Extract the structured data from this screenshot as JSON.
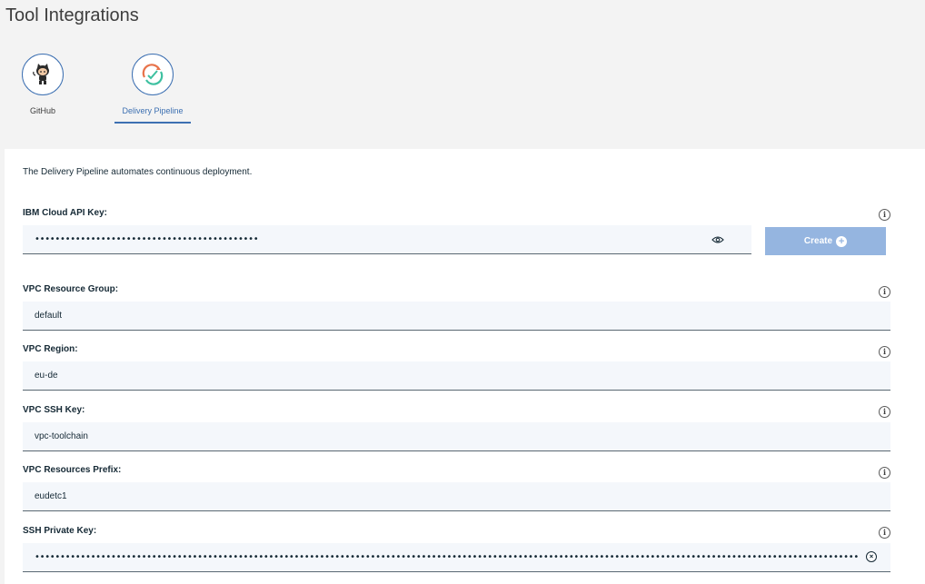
{
  "page": {
    "title": "Tool Integrations"
  },
  "tools": [
    {
      "name": "GitHub",
      "icon": "github-octocat-icon",
      "selected": false
    },
    {
      "name": "Delivery Pipeline",
      "icon": "delivery-pipeline-icon",
      "selected": true
    }
  ],
  "description": "The Delivery Pipeline automates continuous deployment.",
  "fields": {
    "api_key": {
      "label": "IBM Cloud API Key:",
      "value": "••••••••••••••••••••••••••••••••••••••••••••",
      "icon": "eye-icon"
    },
    "create_button": {
      "label": "Create",
      "icon": "plus-circle-icon"
    },
    "resource_group": {
      "label": "VPC Resource Group:",
      "value": "default"
    },
    "region": {
      "label": "VPC Region:",
      "value": "eu-de"
    },
    "ssh_key": {
      "label": "VPC SSH Key:",
      "value": "vpc-toolchain"
    },
    "prefix": {
      "label": "VPC Resources Prefix:",
      "value": "eudetc1"
    },
    "private_key": {
      "label": "SSH Private Key:",
      "value": "••••••••••••••••••••••••••••••••••••••••••••••••••••••••••••••••••••••••••••••••••••••••••••••••••••••••••••••••••••••••••••••••••••••••••••••••••••••••••••••••••••••••••••••••••••••••••••••••••••••••••••••••"
    }
  },
  "info_icon": "i",
  "colors": {
    "accent": "#3d70b2",
    "button_disabled": "#95b5e0",
    "input_bg": "#f4f7fb",
    "page_bg": "#f3f3f3"
  }
}
